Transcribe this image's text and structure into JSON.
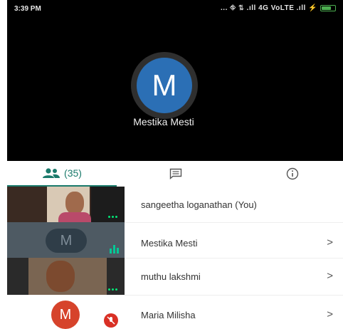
{
  "status_bar": {
    "time": "3:39 PM",
    "network": "... ⛗ ⇅ .ıll 4G VoLTE .ıll ⚡",
    "battery_level": 0.75
  },
  "main_video": {
    "avatar_letter": "M",
    "speaker_name": "Mestika Mesti"
  },
  "tabs": {
    "people_count": "(35)",
    "icons": [
      "people-icon",
      "chat-icon",
      "info-icon"
    ]
  },
  "participants": [
    {
      "name": "sangeetha loganathan (You)",
      "thumb": "camera",
      "indicator": "dots"
    },
    {
      "name": "Mestika Mesti",
      "thumb": "avatar",
      "avatar_letter": "M",
      "indicator": "speaking",
      "chevron": ">"
    },
    {
      "name": "muthu lakshmi",
      "thumb": "camera",
      "indicator": "dots",
      "chevron": ">"
    },
    {
      "name": "Maria Milisha",
      "thumb": "avatar",
      "avatar_letter": "M",
      "indicator": "muted",
      "chevron": ">"
    }
  ],
  "colors": {
    "accent": "#1a7a6b",
    "avatar_blue": "#2b6fb5",
    "avatar_red": "#d6432b",
    "mute_red": "#d93025"
  }
}
